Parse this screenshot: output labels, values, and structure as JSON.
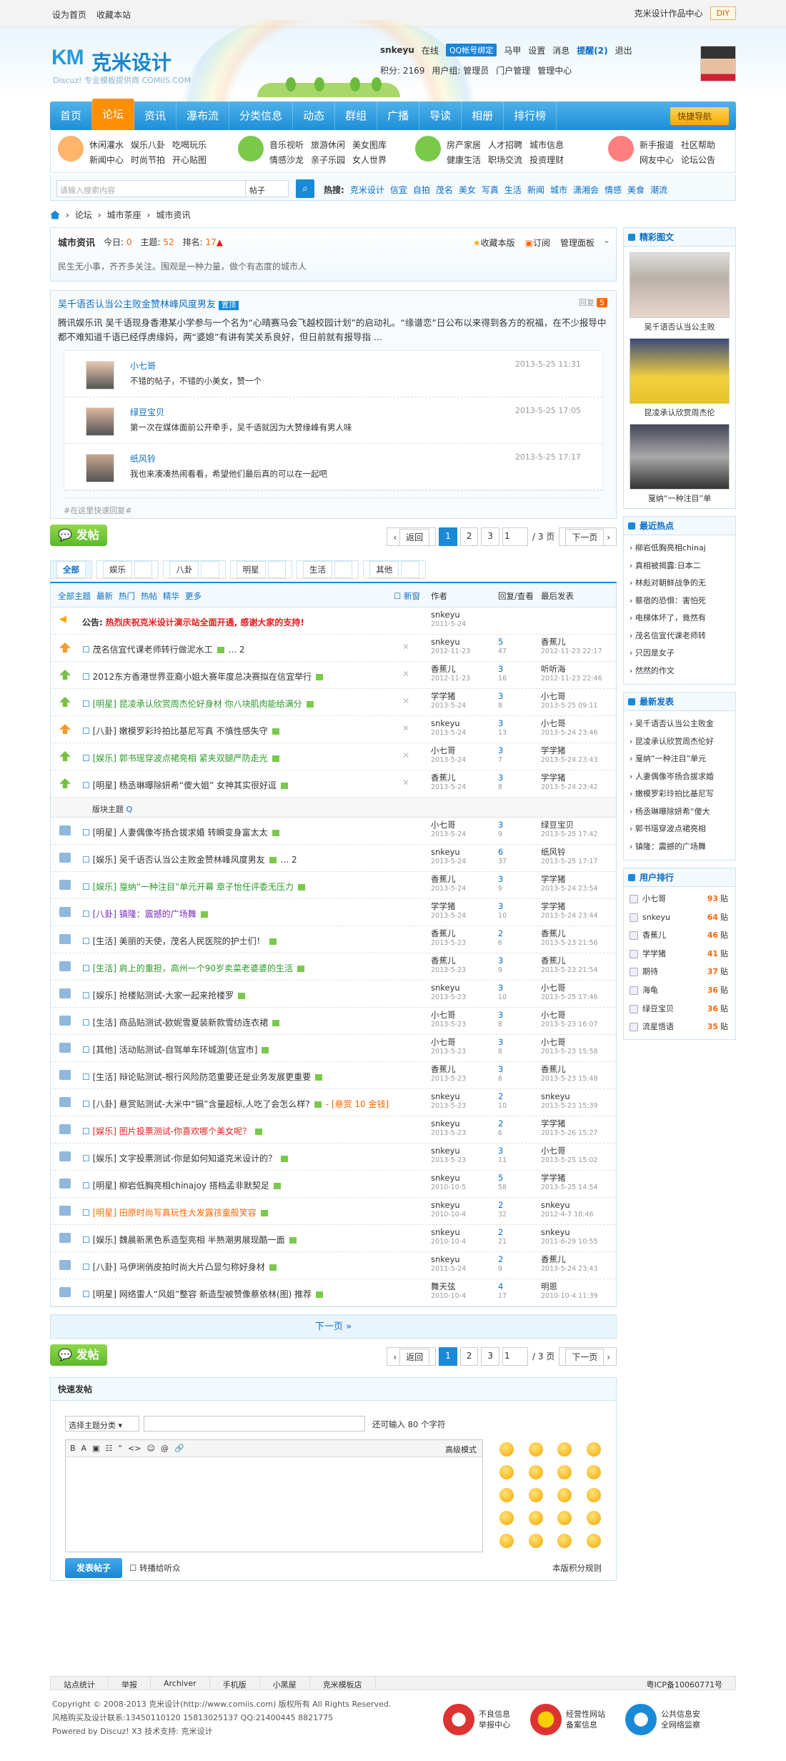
{
  "topbar": {
    "set_home": "设为首页",
    "favorite": "收藏本站",
    "works": "克米设计作品中心",
    "diy": "DIY"
  },
  "logo": {
    "mark": "KM",
    "name": "克米设计",
    "sub": "Discuz! 专业模板提供商  COMIIS.COM"
  },
  "user": {
    "name": "snkeyu",
    "online": "在线",
    "qq": "QQ帐号绑定",
    "hoof": "马甲",
    "settings": "设置",
    "messages": "消息",
    "tips": "提醒(2)",
    "logout": "退出",
    "points": "积分: 2169",
    "group": "用户组: 管理员",
    "portal": "门户管理",
    "manage": "管理中心"
  },
  "nav": {
    "items": [
      "首页",
      "论坛",
      "资讯",
      "瀑布流",
      "分类信息",
      "动态",
      "群组",
      "广播",
      "导读",
      "相册",
      "排行榜"
    ],
    "quick": "快捷导航"
  },
  "subnav": [
    {
      "links": [
        "休闲灌水",
        "娱乐八卦",
        "吃喝玩乐",
        "新闻中心",
        "时尚节拍",
        "开心贴图"
      ]
    },
    {
      "links": [
        "音乐视听",
        "旅游休闲",
        "美女图库",
        "情感沙龙",
        "亲子乐园",
        "女人世界"
      ]
    },
    {
      "links": [
        "房产家居",
        "人才招聘",
        "城市信息",
        "健康生活",
        "职场交流",
        "投资理财"
      ]
    },
    {
      "links": [
        "新手报道",
        "社区帮助",
        "网友中心",
        "论坛公告"
      ]
    }
  ],
  "search": {
    "placeholder": "请输入搜索内容",
    "type": "帖子",
    "hot_label": "热搜:",
    "hot": [
      "克米设计",
      "信宜",
      "自拍",
      "茂名",
      "美女",
      "写真",
      "生活",
      "新闻",
      "城市",
      "潇湘会",
      "情感",
      "美食",
      "潮流"
    ]
  },
  "crumb": [
    "论坛",
    "城市茶座",
    "城市资讯"
  ],
  "forum": {
    "name": "城市资讯",
    "today": "今日: ",
    "today_v": "0",
    "topics": "主题: ",
    "topics_v": "52",
    "rank": "排名: ",
    "rank_v": "17",
    "favorite": "收藏本版",
    "subscribe": "订阅",
    "manage": "管理面板",
    "desc": "民生无小事，齐齐多关注。围观是一种力量，做个有态度的城市人"
  },
  "hotpost": {
    "title": "吴千语否认当公主败金赞林峰风度男友",
    "tag": "置顶",
    "reply_label": "回复",
    "reply_count": "5",
    "text": "腾讯娱乐讯 吴千语现身香港某小学参与一个名为“心晴赛马会飞越校园计划”的启动礼。“缘谱恋”日公布以来得到各方的祝福，在不少报导中都不难知道千语已经俘虏缘妈，两“婆媳”有讲有笑关系良好，但日前就有报导指 ...",
    "replies": [
      {
        "name": "小七哥",
        "text": "不错的帖子，不错的小美女，赞一个",
        "time": "2013-5-25 11:31"
      },
      {
        "name": "绿豆宝贝",
        "text": "第一次在媒体面前公开牵手，吴千语就因为大赞缘峰有男人味",
        "time": "2013-5-25 17:05"
      },
      {
        "name": "纸风铃",
        "text": "我也来凑凑热闹看看，希望他们最后真的可以在一起吧",
        "time": "2013-5-25 17:17"
      }
    ],
    "quick": "#在这里快速回复#"
  },
  "pager": {
    "post": "发帖",
    "back": "返回",
    "pages": [
      "1",
      "2",
      "3"
    ],
    "input": "1",
    "total": "/ 3 页",
    "next": "下一页"
  },
  "cats": [
    {
      "n": "全部",
      "c": ""
    },
    {
      "n": "娱乐",
      "c": "9"
    },
    {
      "n": "八卦",
      "c": "6"
    },
    {
      "n": "明星",
      "c": "6"
    },
    {
      "n": "生活",
      "c": "4"
    },
    {
      "n": "其他",
      "c": "1"
    }
  ],
  "thead": {
    "filters": [
      "全部主题",
      "最新",
      "热门",
      "热帖",
      "精华",
      "更多"
    ],
    "new": "新窗",
    "author": "作者",
    "reply": "回复/查看",
    "last": "最后发表"
  },
  "announce": {
    "label": "公告:",
    "text": "热烈庆祝克米设计演示站全面开通, 感谢大家的支持!",
    "author": "snkeyu",
    "date": "2011-5-24"
  },
  "sticky": [
    {
      "t": "茂名信宜代课老师转行做泥水工",
      "page": "... 2",
      "cls": "",
      "au": "snkeyu",
      "ad": "2012-11-23",
      "r": "5",
      "v": "47",
      "l": "香蕉儿",
      "ld": "2012-11-23 22:17"
    },
    {
      "t": "2012东方香港世界亚裔小姐大赛年度总决赛拟在信宜举行",
      "page": "",
      "cls": "",
      "au": "香蕉儿",
      "ad": "2012-11-23",
      "r": "3",
      "v": "16",
      "l": "听听海",
      "ld": "2012-11-23 22:46"
    },
    {
      "t": "[明星] 昆凌承认欣赏周杰伦好身材 你八块肌肉能给满分",
      "page": "",
      "cls": "c-green",
      "au": "学学猪",
      "ad": "2013-5-24",
      "r": "3",
      "v": "8",
      "l": "小七哥",
      "ld": "2013-5-25 09:11"
    },
    {
      "t": "[八卦] 嫩模罗彩玲拍比基尼写真 不慎性感失守",
      "page": "",
      "cls": "",
      "au": "snkeyu",
      "ad": "2013-5-24",
      "r": "3",
      "v": "13",
      "l": "小七哥",
      "ld": "2013-5-24 23:46"
    },
    {
      "t": "[娱乐] 郭书瑶穿波点裙亮相 紧夹双腿严防走光",
      "page": "",
      "cls": "c-green",
      "au": "小七哥",
      "ad": "2013-5-24",
      "r": "3",
      "v": "7",
      "l": "学学猪",
      "ld": "2013-5-24 23:43"
    },
    {
      "t": "[明星] 杨丞琳曝除妍希“傻大姐” 女神其实很好逗",
      "page": "",
      "cls": "",
      "au": "香蕉儿",
      "ad": "2013-5-24",
      "r": "3",
      "v": "8",
      "l": "学学猪",
      "ld": "2013-5-24 23:42"
    }
  ],
  "sep": "版块主题",
  "threads": [
    {
      "t": "[明星] 人妻偶像岑扬合拔求婚 转瞬变身富太太",
      "cls": "",
      "au": "小七哥",
      "ad": "2013-5-24",
      "r": "3",
      "v": "9",
      "l": "绿豆宝贝",
      "ld": "2013-5-25 17:42"
    },
    {
      "t": "[娱乐] 吴千语否认当公主败金赞林峰风度男友",
      "page": "... 2",
      "cls": "",
      "au": "snkeyu",
      "ad": "2013-5-24",
      "r": "6",
      "v": "37",
      "l": "纸风铃",
      "ld": "2013-5-25 17:17"
    },
    {
      "t": "[娱乐] 戛纳“一种注目”单元开幕 章子怡任评委无压力",
      "cls": "c-green",
      "au": "香蕉儿",
      "ad": "2013-5-24",
      "r": "3",
      "v": "9",
      "l": "学学猪",
      "ld": "2013-5-24 23:54"
    },
    {
      "t": "[八卦] 镇隆：震撼的广场舞",
      "cls": "c-purple",
      "au": "学学猪",
      "ad": "2013-5-24",
      "r": "3",
      "v": "10",
      "l": "学学猪",
      "ld": "2013-5-24 23:44"
    },
    {
      "t": "[生活] 美丽的天使，茂名人民医院的护士们！",
      "cls": "",
      "au": "香蕉儿",
      "ad": "2013-5-23",
      "r": "2",
      "v": "6",
      "l": "香蕉儿",
      "ld": "2013-5-23 21:56"
    },
    {
      "t": "[生活] 肩上的重担，高州一个90岁卖菜老婆婆的生活",
      "cls": "c-green",
      "au": "香蕉儿",
      "ad": "2013-5-23",
      "r": "3",
      "v": "9",
      "l": "香蕉儿",
      "ld": "2013-5-23 21:54"
    },
    {
      "t": "[娱乐] 抢楼贴测试-大家一起来抢楼罗",
      "cls": "",
      "au": "snkeyu",
      "ad": "2013-5-23",
      "r": "3",
      "v": "10",
      "l": "小七哥",
      "ld": "2013-5-25 17:46"
    },
    {
      "t": "[生活] 商品贴测试-欧妮雪夏装新款雪纺连衣裙",
      "cls": "",
      "au": "小七哥",
      "ad": "2013-5-23",
      "r": "3",
      "v": "8",
      "l": "小七哥",
      "ld": "2013-5-23 16:07"
    },
    {
      "t": "[其他] 活动贴测试-自驾单车环城游[信宜市]",
      "cls": "",
      "au": "小七哥",
      "ad": "2013-5-23",
      "r": "3",
      "v": "8",
      "l": "小七哥",
      "ld": "2013-5-23 15:58"
    },
    {
      "t": "[生活] 辩论贴测试-根行风险防范重要还是业务发展更重要",
      "cls": "",
      "au": "香蕉儿",
      "ad": "2013-5-23",
      "r": "3",
      "v": "6",
      "l": "香蕉儿",
      "ld": "2013-5-23 15:48"
    },
    {
      "t": "[八卦] 悬赏贴测试-大米中“镉”含量超标,人吃了会怎么样?",
      "extra": "- [悬赏 10 金钱]",
      "cls": "",
      "au": "snkeyu",
      "ad": "2013-5-23",
      "r": "2",
      "v": "10",
      "l": "snkeyu",
      "ld": "2013-5-23 15:39"
    },
    {
      "t": "[娱乐] 图片投票测试-你喜欢哪个美女呢？",
      "cls": "c-red",
      "au": "snkeyu",
      "ad": "2013-5-23",
      "r": "2",
      "v": "6",
      "l": "学学猪",
      "ld": "2013-5-26 15:27"
    },
    {
      "t": "[娱乐] 文字投票测试-你是如何知道克米设计的？",
      "cls": "",
      "au": "snkeyu",
      "ad": "2013-5-23",
      "r": "3",
      "v": "11",
      "l": "小七哥",
      "ld": "2013-5-25 15:02"
    },
    {
      "t": "[明星] 柳岩低胸亮相chinajoy 搭档孟非默契足",
      "cls": "",
      "au": "snkeyu",
      "ad": "2010-10-5",
      "r": "5",
      "v": "58",
      "l": "学学猪",
      "ld": "2013-5-25 14:54"
    },
    {
      "t": "[明星] 田原时尚写真玩性大发露孩童般笑容",
      "cls": "c-orange",
      "au": "snkeyu",
      "ad": "2010-10-4",
      "r": "2",
      "v": "32",
      "l": "snkeyu",
      "ld": "2012-4-7 18:46"
    },
    {
      "t": "[娱乐] 魏晨新黑色系造型亮相 半熟潮男展现酷一面",
      "cls": "",
      "au": "snkeyu",
      "ad": "2010-10-4",
      "r": "2",
      "v": "21",
      "l": "snkeyu",
      "ld": "2011-6-29 10:55"
    },
    {
      "t": "[八卦] 马伊琍俏皮拍时尚大片凸显匀称好身材",
      "cls": "",
      "au": "snkeyu",
      "ad": "2011-5-24",
      "r": "2",
      "v": "9",
      "l": "香蕉儿",
      "ld": "2013-5-24 23:43"
    },
    {
      "t": "[明星] 网络雷人“风姐”整容 新造型被赞像蔡依林(图) 推荐",
      "cls": "",
      "au": "舞天弦",
      "ad": "2010-10-4",
      "r": "4",
      "v": "17",
      "l": "明恩",
      "ld": "2010-10-4 11:39"
    }
  ],
  "nextpage": "下一页 »",
  "fastpost": {
    "title": "快速发帖",
    "select": "选择主题分类",
    "count": "还可输入 80 个字符",
    "mode": "高级模式",
    "tools": [
      "B",
      "A",
      "▣",
      "☷",
      "“",
      "<>",
      "☺",
      "@",
      "🔗"
    ],
    "submit": "发表帖子",
    "sync": "转播给听众",
    "rule": "本版积分规则"
  },
  "side": {
    "pics": {
      "title": "精彩图文",
      "items": [
        "吴千语否认当公主败",
        "昆凌承认欣赏周杰伦",
        "戛纳“一种注目”单"
      ]
    },
    "hot": {
      "title": "最近热点",
      "items": [
        "柳岩低胸亮相chinaj",
        "真相被揭露:日本二",
        "林彪对朝鲜战争的无",
        "蔡宿的恐惧：害怕死",
        "电梯体坏了，竟然有",
        "茂名信宜代课老师转",
        "只因是女子",
        "然然的作文"
      ]
    },
    "latest": {
      "title": "最新发表",
      "items": [
        "吴千语否认当公主败金",
        "昆凌承认欣赏周杰伦好",
        "戛纳“一种注目”单元",
        "人妻偶像岑扬合拔求婚",
        "嫩模罗彩玲拍比基尼写",
        "杨丞琳曝除妍希“傻大",
        "郭书瑶穿波点裙亮相",
        "镇隆：震撼的广场舞"
      ]
    },
    "rank": {
      "title": "用户排行",
      "unit": "贴",
      "items": [
        {
          "n": "小七哥",
          "v": "93"
        },
        {
          "n": "snkeyu",
          "v": "64"
        },
        {
          "n": "香蕉儿",
          "v": "46"
        },
        {
          "n": "学学猪",
          "v": "41"
        },
        {
          "n": "期待",
          "v": "37"
        },
        {
          "n": "海龟",
          "v": "36"
        },
        {
          "n": "绿豆宝贝",
          "v": "36"
        },
        {
          "n": "流星悟语",
          "v": "35"
        }
      ]
    }
  },
  "footnav": {
    "items": [
      "站点统计",
      "举报",
      "Archiver",
      "手机版",
      "小黑屋",
      "克米模板店"
    ],
    "icp": "粤ICP备10060771号"
  },
  "footer": {
    "l1": "Copyright © 2008-2013 克米设计(http://www.comiis.com) 版权所有 All Rights Reserved.",
    "l2": "风格购买及设计联系:13450110120 15813025137 QQ:21400445 8821775",
    "l3": "Powered by Discuz! X3  技术支持: 克米设计"
  },
  "badges": [
    {
      "a": "不良信息",
      "b": "举报中心"
    },
    {
      "a": "经营性网站",
      "b": "备案信息"
    },
    {
      "a": "公共信息安",
      "b": "全网络监察"
    }
  ]
}
